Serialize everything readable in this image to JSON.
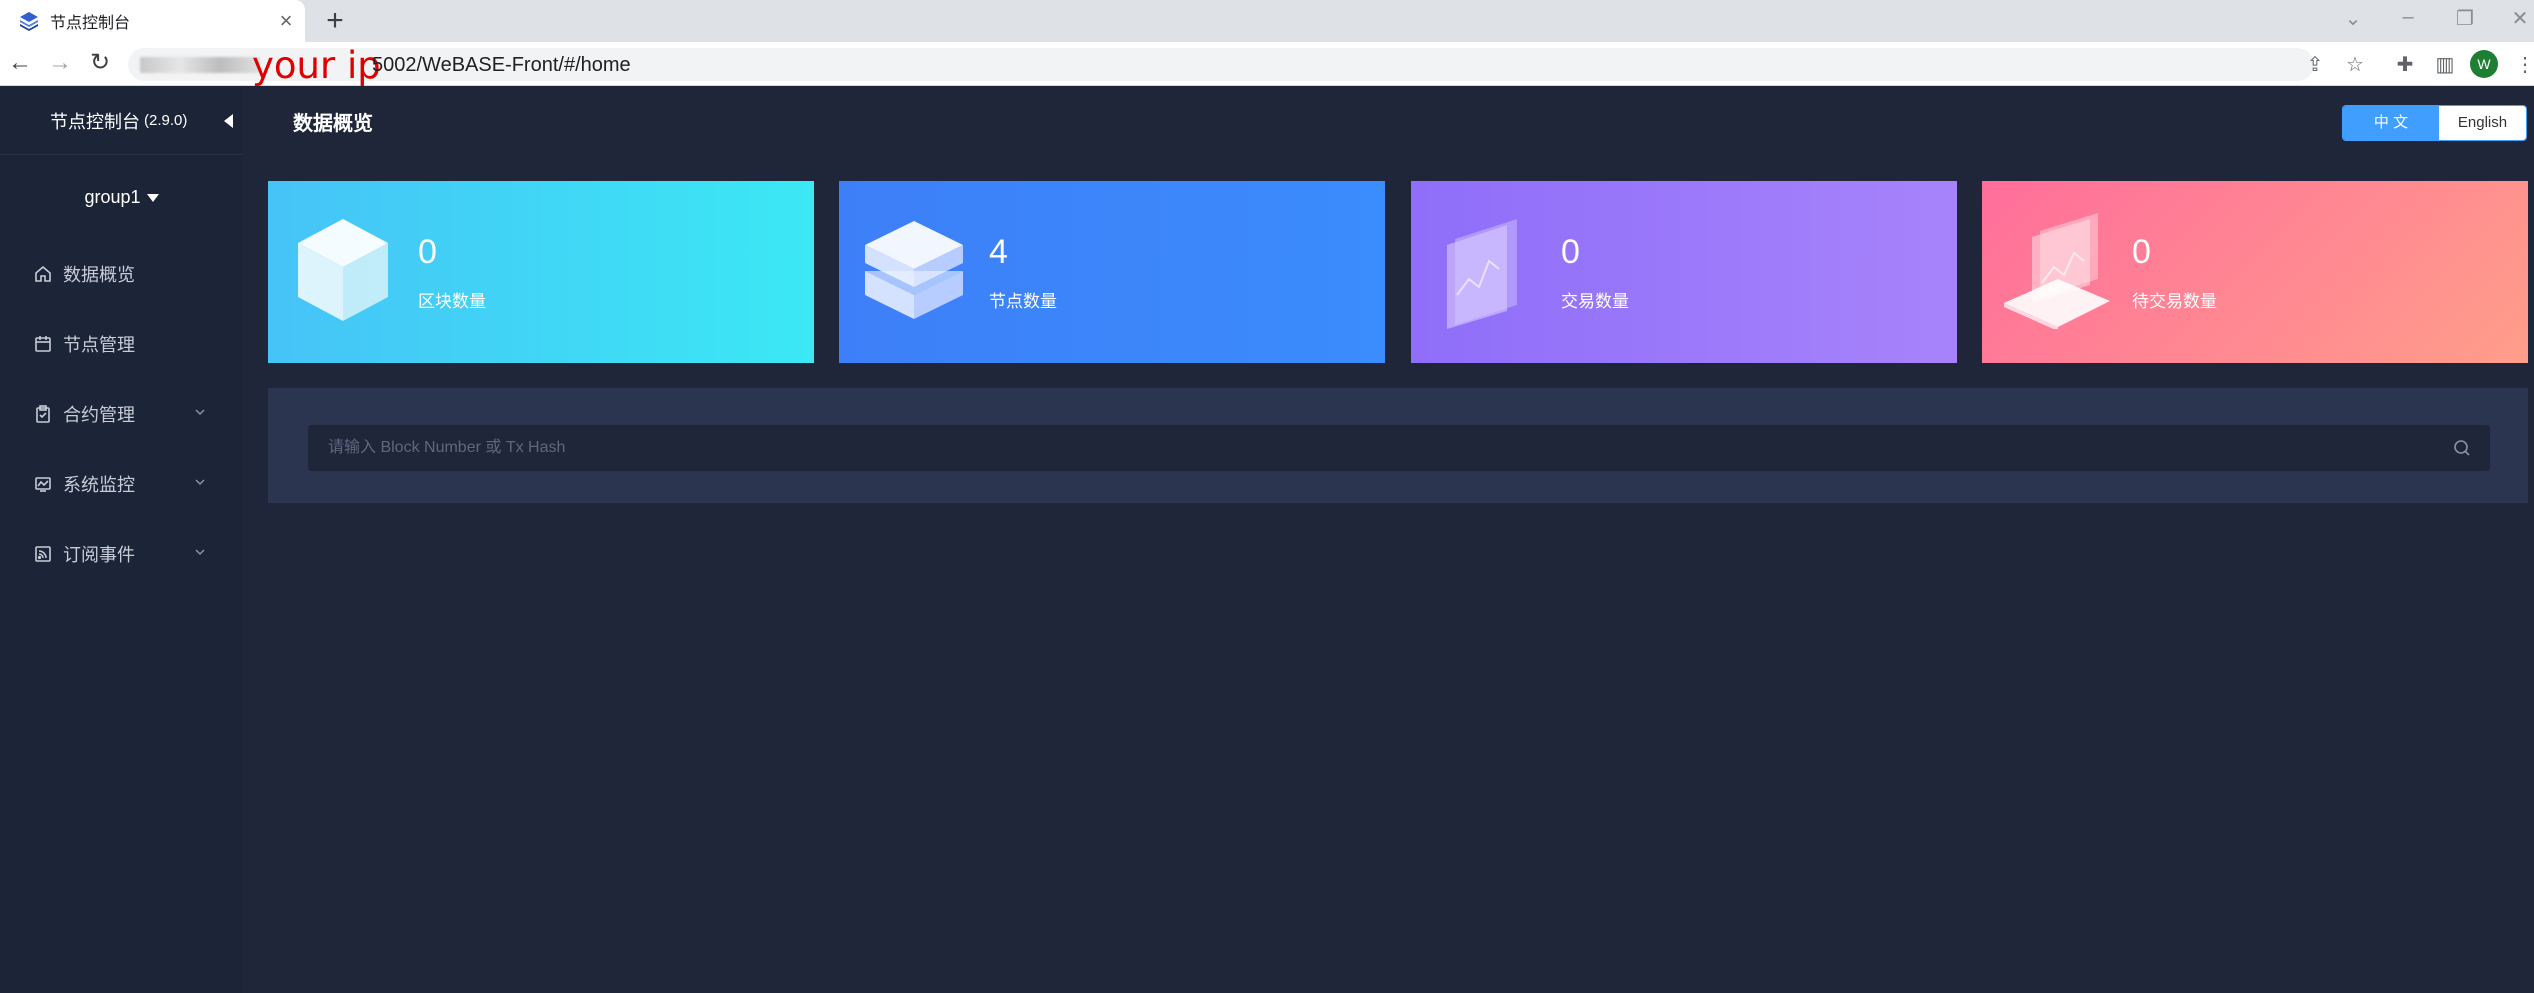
{
  "browser": {
    "tab_title": "节点控制台",
    "ip_annotation": "your ip",
    "url_suffix": "5002/WeBASE-Front/#/home",
    "avatar_letter": "W"
  },
  "sidebar": {
    "brand": "节点控制台",
    "version": "(2.9.0)",
    "group": "group1",
    "items": [
      {
        "label": "数据概览",
        "icon": "home-icon"
      },
      {
        "label": "节点管理",
        "icon": "calendar-icon"
      },
      {
        "label": "合约管理",
        "icon": "clipboard-icon",
        "expandable": true
      },
      {
        "label": "系统监控",
        "icon": "monitor-icon",
        "expandable": true
      },
      {
        "label": "订阅事件",
        "icon": "rss-icon",
        "expandable": true
      }
    ]
  },
  "header": {
    "title": "数据概览",
    "lang_zh": "中 文",
    "lang_en": "English",
    "active_lang": "zh"
  },
  "stats": [
    {
      "value": "0",
      "label": "区块数量",
      "icon": "cube-icon"
    },
    {
      "value": "4",
      "label": "节点数量",
      "icon": "server-stack-icon"
    },
    {
      "value": "0",
      "label": "交易数量",
      "icon": "chart-panel-icon"
    },
    {
      "value": "0",
      "label": "待交易数量",
      "icon": "laptop-chart-icon"
    }
  ],
  "search": {
    "placeholder": "请输入 Block Number 或 Tx Hash"
  },
  "colors": {
    "background": "#1f2639",
    "sidebar": "#1c2437",
    "accent": "#409eff",
    "card_blocks": "#3be8f4",
    "card_nodes": "#3d7ff8",
    "card_tx": "#9b78fa",
    "card_pending": "#ff7c96"
  }
}
